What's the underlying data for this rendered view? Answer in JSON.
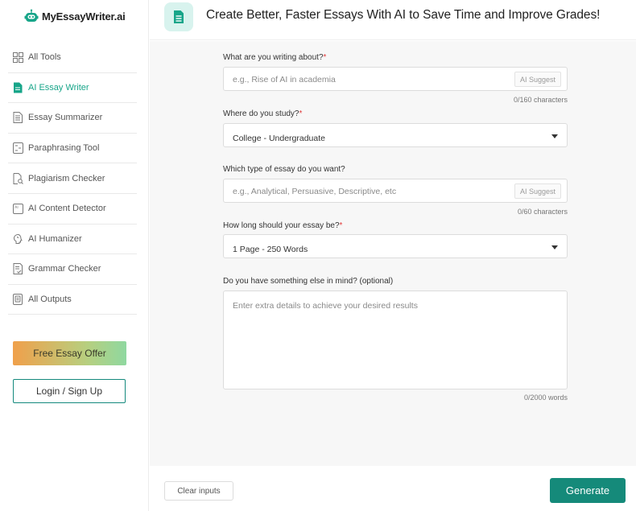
{
  "brand": {
    "name": "MyEssayWriter.ai",
    "accent": "#17a589",
    "button_color": "#158a7a"
  },
  "sidebar": {
    "items": [
      {
        "label": "All Tools",
        "icon": "grid-icon",
        "active": false
      },
      {
        "label": "AI Essay Writer",
        "icon": "document-icon",
        "active": true
      },
      {
        "label": "Essay Summarizer",
        "icon": "list-document-icon",
        "active": false
      },
      {
        "label": "Paraphrasing Tool",
        "icon": "paraphrase-icon",
        "active": false
      },
      {
        "label": "Plagiarism Checker",
        "icon": "file-search-icon",
        "active": false
      },
      {
        "label": "AI Content Detector",
        "icon": "ai-detector-icon",
        "active": false
      },
      {
        "label": "AI Humanizer",
        "icon": "brain-icon",
        "active": false
      },
      {
        "label": "Grammar Checker",
        "icon": "grammar-icon",
        "active": false
      },
      {
        "label": "All Outputs",
        "icon": "outputs-icon",
        "active": false
      }
    ],
    "offer_label": "Free Essay Offer",
    "login_label": "Login / Sign Up"
  },
  "header": {
    "title": "Create Better, Faster Essays With AI to Save Time and Improve Grades!"
  },
  "form": {
    "topic": {
      "label": "What are you writing about?",
      "required_mark": "*",
      "placeholder": "e.g., Rise of AI in academia",
      "suggest_label": "AI Suggest",
      "counter": "0/160 characters"
    },
    "study": {
      "label": "Where do you study?",
      "required_mark": "*",
      "value": "College - Undergraduate"
    },
    "type": {
      "label": "Which type of essay do you want?",
      "placeholder": "e.g., Analytical, Persuasive, Descriptive, etc",
      "suggest_label": "AI Suggest",
      "counter": "0/60 characters"
    },
    "length": {
      "label": "How long should your essay be?",
      "required_mark": "*",
      "value": "1 Page - 250 Words"
    },
    "extra": {
      "label": "Do you have something else in mind? (optional)",
      "placeholder": "Enter extra details to achieve your desired results",
      "counter": "0/2000 words"
    }
  },
  "footer": {
    "clear_label": "Clear inputs",
    "generate_label": "Generate"
  }
}
